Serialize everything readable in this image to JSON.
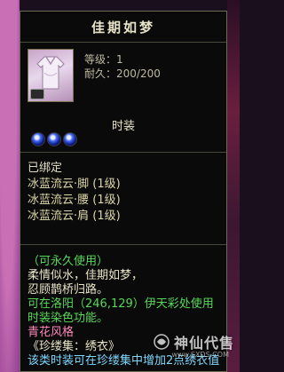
{
  "tooltip": {
    "title": "佳期如梦",
    "stats": {
      "level": "等级：1",
      "durability": "耐久：200/200"
    },
    "category": "时装",
    "gems": [
      "blue-orb-icon",
      "blue-orb-icon",
      "blue-orb-icon"
    ],
    "bind_status": "已绑定",
    "set_items": [
      "冰蓝流云·脚 (1级)",
      "冰蓝流云·腰 (1级)",
      "冰蓝流云·肩 (1级)"
    ],
    "description": {
      "permanent": "（可永久使用）",
      "flavor_line1": "柔情似水，佳期如梦，",
      "flavor_line2": "忍顾鹊桥归路。",
      "dye_info": "可在洛阳（246,129）伊天彩处使用时装染色功能。",
      "style": "青花风格",
      "collection": "《珍缕集：绣衣》",
      "collection_note": "该类时装可在珍缕集中增加2点绣衣值"
    }
  },
  "watermark": {
    "text": "神仙代售",
    "url": "www.SXDS.COM"
  },
  "colors": {
    "title": "#e8e4c8",
    "green": "#58d858",
    "set": "#dcd6a8",
    "style": "#ff88b8"
  }
}
